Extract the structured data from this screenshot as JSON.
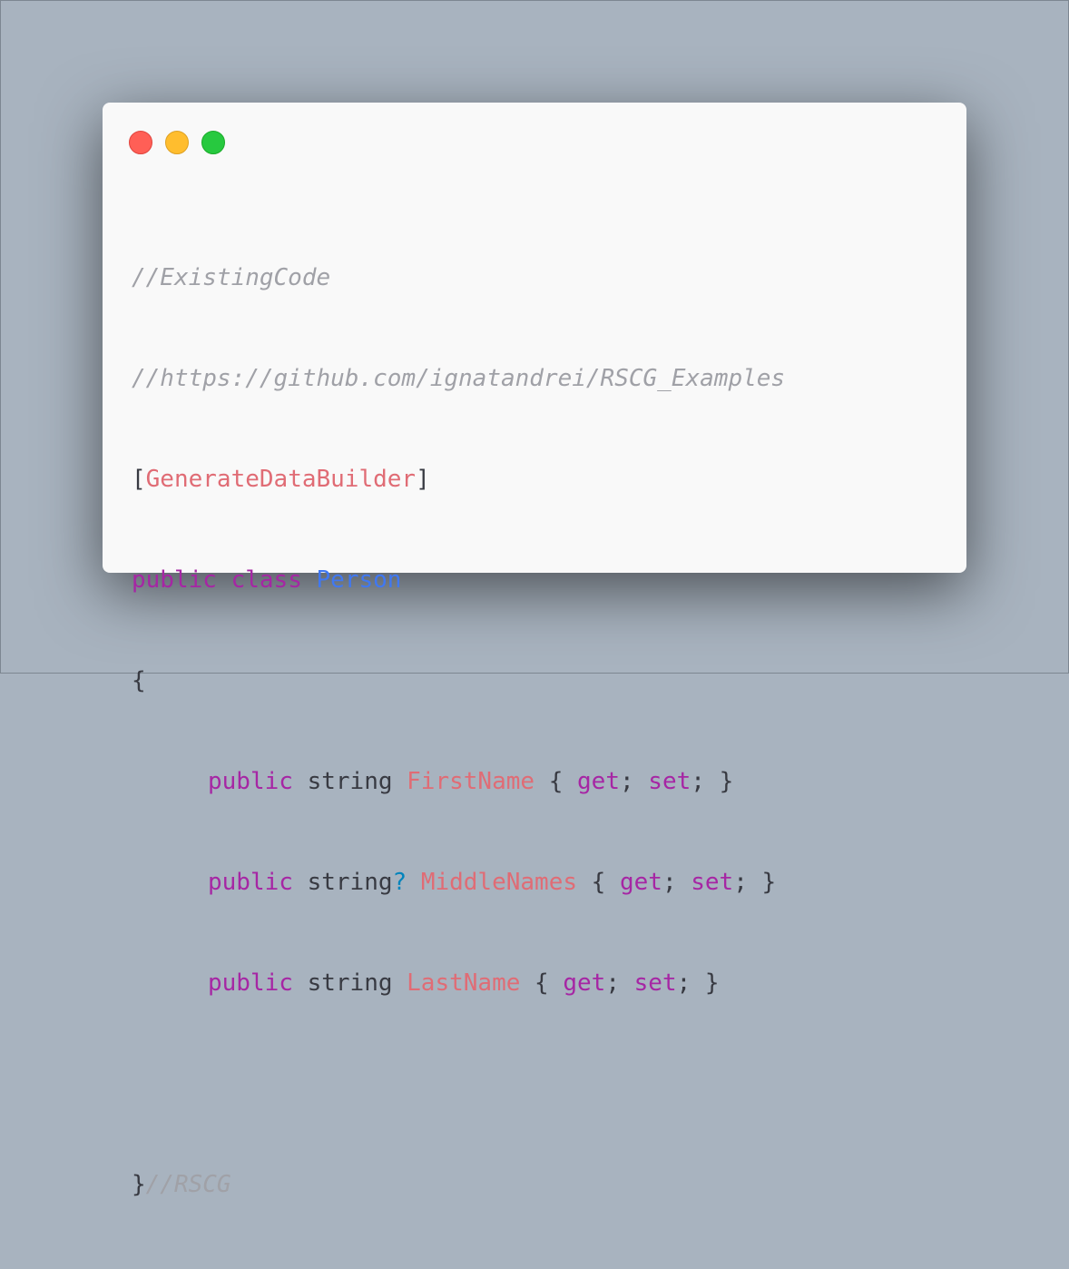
{
  "window": {
    "controls": [
      "close",
      "minimize",
      "maximize"
    ]
  },
  "code": {
    "comment1": "//ExistingCode",
    "comment2": "//https://github.com/ignatandrei/RSCG_Examples",
    "attr_open": "[",
    "attr_name": "GenerateDataBuilder",
    "attr_close": "]",
    "kw_public": "public",
    "kw_class": "class",
    "class_name": "Person",
    "brace_open": "{",
    "type_string": "string",
    "nullable": "?",
    "prop1": "FirstName",
    "prop2": "MiddleNames",
    "prop3": "LastName",
    "acc_open": "{ ",
    "kw_get": "get",
    "semi": "; ",
    "kw_set": "set",
    "acc_close": "; }",
    "brace_close": "}",
    "end_comment": "//RSCG"
  },
  "colors": {
    "background": "#a8b3bf",
    "window": "#f9f9f9",
    "keyword": "#a626a4",
    "class": "#4078f2",
    "identifier": "#e06c75",
    "comment": "#a0a1a7"
  }
}
